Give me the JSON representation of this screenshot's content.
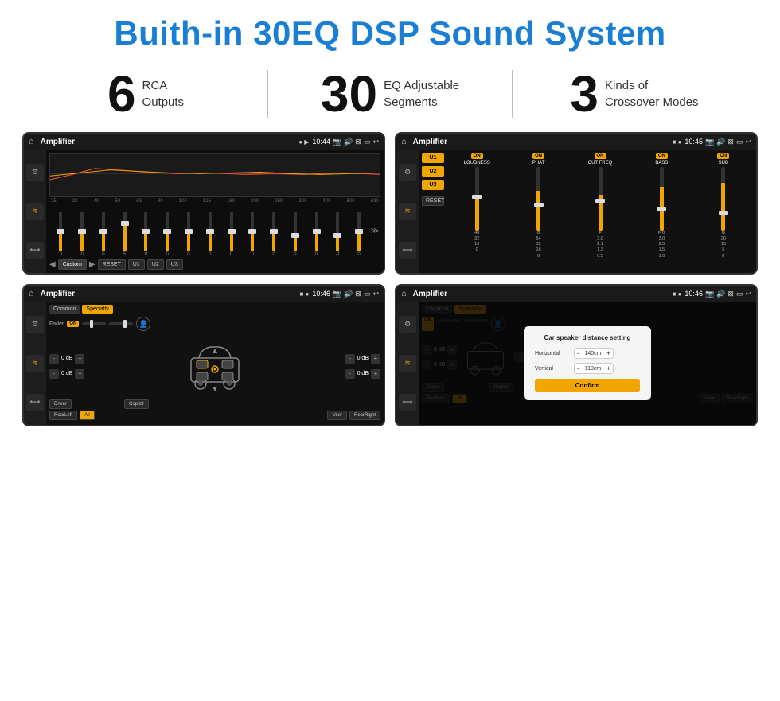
{
  "title": "Buith-in 30EQ DSP Sound System",
  "features": [
    {
      "number": "6",
      "text": "RCA\nOutputs"
    },
    {
      "number": "30",
      "text": "EQ Adjustable\nSegments"
    },
    {
      "number": "3",
      "text": "Kinds of\nCrossover Modes"
    }
  ],
  "screens": [
    {
      "id": "eq-main",
      "status_time": "10:44",
      "app_name": "Amplifier",
      "description": "EQ Slider Screen",
      "eq_bands": [
        "25",
        "32",
        "40",
        "50",
        "63",
        "80",
        "100",
        "125",
        "160",
        "200",
        "250",
        "320",
        "400",
        "500",
        "630"
      ],
      "eq_values": [
        "0",
        "0",
        "0",
        "5",
        "0",
        "0",
        "0",
        "0",
        "0",
        "0",
        "0",
        "-1",
        "0",
        "-1"
      ],
      "preset_label": "Custom",
      "bottom_btns": [
        "RESET",
        "U1",
        "U2",
        "U3"
      ]
    },
    {
      "id": "crossover",
      "status_time": "10:45",
      "app_name": "Amplifier",
      "description": "Crossover Settings",
      "presets": [
        "U1",
        "U2",
        "U3"
      ],
      "units": [
        {
          "label": "LOUDNESS",
          "on": true
        },
        {
          "label": "PHAT",
          "on": true
        },
        {
          "label": "CUT FREQ",
          "on": true
        },
        {
          "label": "BASS",
          "on": true
        },
        {
          "label": "SUB",
          "on": true
        }
      ],
      "reset_label": "RESET"
    },
    {
      "id": "speaker-fader",
      "status_time": "10:46",
      "app_name": "Amplifier",
      "description": "Speaker Fader Screen",
      "tabs": [
        "Common",
        "Specialty"
      ],
      "active_tab": "Specialty",
      "fader_label": "Fader",
      "fader_on": "ON",
      "db_values": [
        "0 dB",
        "0 dB",
        "0 dB",
        "0 dB"
      ],
      "bottom_btns": [
        "Driver",
        "Copilot",
        "RearLeft",
        "All",
        "User",
        "RearRight"
      ]
    },
    {
      "id": "speaker-distance",
      "status_time": "10:46",
      "app_name": "Amplifier",
      "description": "Car Speaker Distance Setting",
      "tabs": [
        "Common",
        "Specialty"
      ],
      "dialog_title": "Car speaker distance setting",
      "horizontal_label": "Horizontal",
      "horizontal_value": "140cm",
      "vertical_label": "Vertical",
      "vertical_value": "110cm",
      "confirm_label": "Confirm",
      "db_values": [
        "0 dB",
        "0 dB"
      ],
      "bottom_btns": [
        "Driver",
        "Copilot",
        "RearLeft",
        "All",
        "User",
        "RearRight"
      ]
    }
  ]
}
